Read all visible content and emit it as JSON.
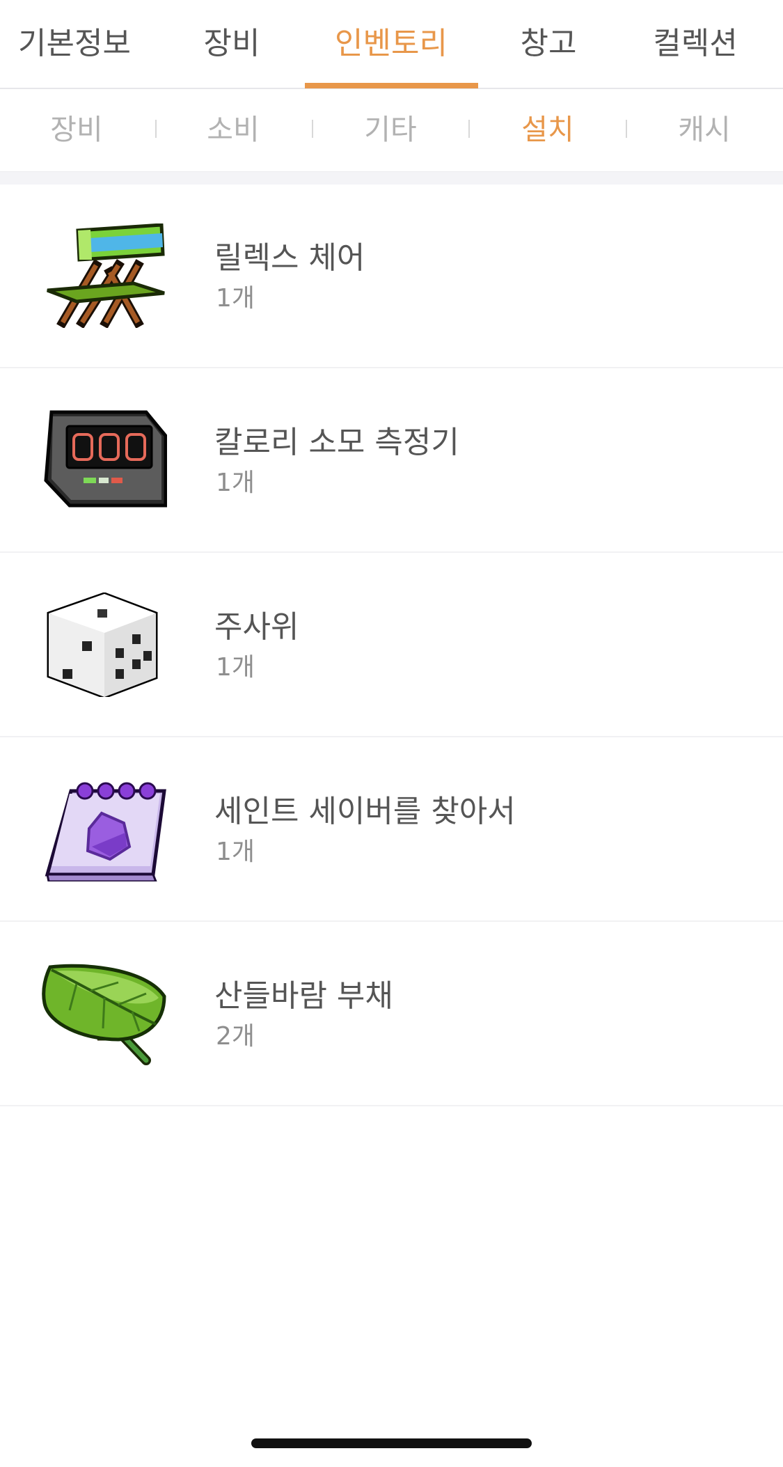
{
  "main_tabs": [
    {
      "label": "기본정보",
      "active": false
    },
    {
      "label": "장비",
      "active": false
    },
    {
      "label": "인벤토리",
      "active": true
    },
    {
      "label": "창고",
      "active": false
    },
    {
      "label": "컬렉션",
      "active": false
    }
  ],
  "sub_tabs": [
    {
      "label": "장비",
      "active": false
    },
    {
      "label": "소비",
      "active": false
    },
    {
      "label": "기타",
      "active": false
    },
    {
      "label": "설치",
      "active": true
    },
    {
      "label": "캐시",
      "active": false
    }
  ],
  "items": [
    {
      "name": "릴렉스 체어",
      "count": "1개",
      "icon": "folding-chair-icon"
    },
    {
      "name": "칼로리 소모 측정기",
      "count": "1개",
      "icon": "calorie-counter-icon"
    },
    {
      "name": "주사위",
      "count": "1개",
      "icon": "dice-icon"
    },
    {
      "name": "세인트 세이버를 찾아서",
      "count": "1개",
      "icon": "notebook-icon"
    },
    {
      "name": "산들바람 부채",
      "count": "2개",
      "icon": "leaf-fan-icon"
    }
  ],
  "colors": {
    "accent": "#e8974a",
    "text": "#555555",
    "muted": "#b2b2b2"
  }
}
